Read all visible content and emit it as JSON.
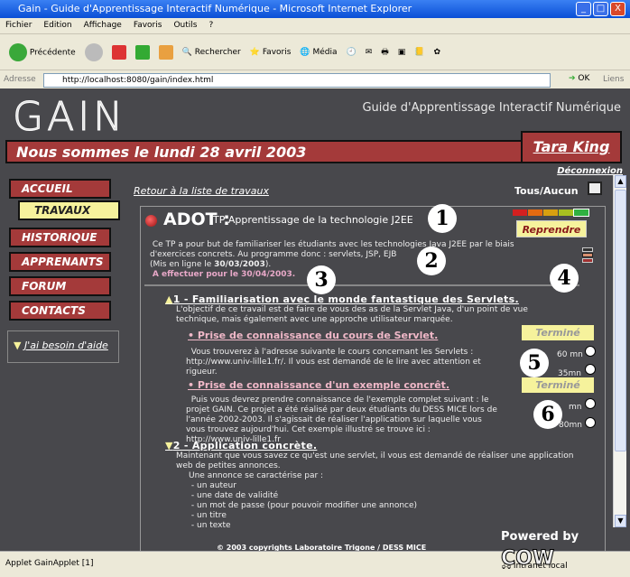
{
  "window": {
    "title": "Gain - Guide d'Apprentissage Interactif Numérique - Microsoft Internet Explorer",
    "buttons": [
      "_",
      "□",
      "X"
    ]
  },
  "menu": [
    "Fichier",
    "Edition",
    "Affichage",
    "Favoris",
    "Outils",
    "?"
  ],
  "toolbar": {
    "back": "Précédente",
    "search": "Rechercher",
    "favorites": "Favoris",
    "media": "Média"
  },
  "address": {
    "label": "Adresse",
    "url": "http://localhost:8080/gain/index.html",
    "go": "OK",
    "links": "Liens"
  },
  "header": {
    "logo": "GAIN",
    "subtitle": "Guide d'Apprentissage Interactif Numérique",
    "date": "Nous sommes le lundi 28 avril 2003",
    "user": "Tara King",
    "logout": "Déconnexion"
  },
  "nav": [
    {
      "label": "ACCUEIL"
    },
    {
      "label": "TRAVAUX",
      "active": true
    },
    {
      "label": "HISTORIQUE"
    },
    {
      "label": "APPRENANTS"
    },
    {
      "label": "FORUM"
    },
    {
      "label": "CONTACTS"
    }
  ],
  "help": "J'ai besoin d'aide",
  "main": {
    "back_link": "Retour à la liste de travaux",
    "all": "Tous",
    "sep": "/",
    "none": "Aucun",
    "tp": {
      "code": "ADOT :",
      "title": "TP Apprentissage de la technologie J2EE",
      "button": "Reprendre",
      "difficulty_colors": [
        "#d42020",
        "#e46a10",
        "#d8a010",
        "#a8c020",
        "#30b040"
      ],
      "difficulty_selected": 5,
      "desc1": "Ce TP a pour but de familiariser les étudiants avec les technologies Java J2EE par le biais",
      "desc2": "d'exercices concrets. Au programme donc : servlets, JSP, EJB",
      "online_prefix": "(Mis en ligne le ",
      "online_date": "30/03/2003",
      "online_suffix": ").",
      "due": "A effectuer pour le 30/04/2003."
    },
    "sections": [
      {
        "title": "1 - Familiarisation avec le monde fantastique des Servlets.",
        "text1": "L'objectif de ce travail est de faire de vous des as de la Servlet Java, d'un point de vue",
        "text2": "technique, mais également avec une approche utilisateur marquée.",
        "tasks": [
          {
            "title": "• Prise de connaissance du cours de Servlet.",
            "status": "Terminé",
            "estimated": "60 mn",
            "spent": "35mn",
            "lines": [
              "Vous trouverez à l'adresse suivante le cours concernant les Servlets :",
              "http://www.univ-lille1.fr/. Il vous est demandé de le lire avec attention et",
              "rigueur."
            ]
          },
          {
            "title": "• Prise de connaissance d'un exemple concrêt.",
            "status": "Terminé",
            "estimated": "mn",
            "spent": "80mn",
            "lines": [
              "Puis vous devrez prendre connaissance de l'exemple complet suivant : le",
              "projet GAIN. Ce projet a été réalisé par deux étudiants du DESS MICE lors de",
              "l'année 2002-2003. Il s'agissait de réaliser l'application sur laquelle vous",
              "vous trouvez aujourd'hui. Cet exemple illustré se trouve ici :",
              "http://www.univ-lille1.fr"
            ]
          }
        ]
      },
      {
        "title": "2 - Application concrète.",
        "lines": [
          "Maintenant que vous savez ce qu'est une servlet, il vous est demandé de réaliser une application",
          "web de petites annonces.",
          "Une annonce se caractérise par :",
          "- un auteur",
          "- une date de validité",
          "- un mot de passe (pour pouvoir modifier une annonce)",
          "- un titre",
          "- un texte"
        ]
      }
    ],
    "callouts": [
      "1",
      "2",
      "3",
      "4",
      "5",
      "6"
    ]
  },
  "footer": {
    "copyright": "© 2003 copyrights Laboratoire Trigone / DESS MICE",
    "powered": "Powered by",
    "cow": "COW"
  },
  "status": {
    "left": "Applet GainApplet [1]",
    "zone": "Intranet local"
  }
}
